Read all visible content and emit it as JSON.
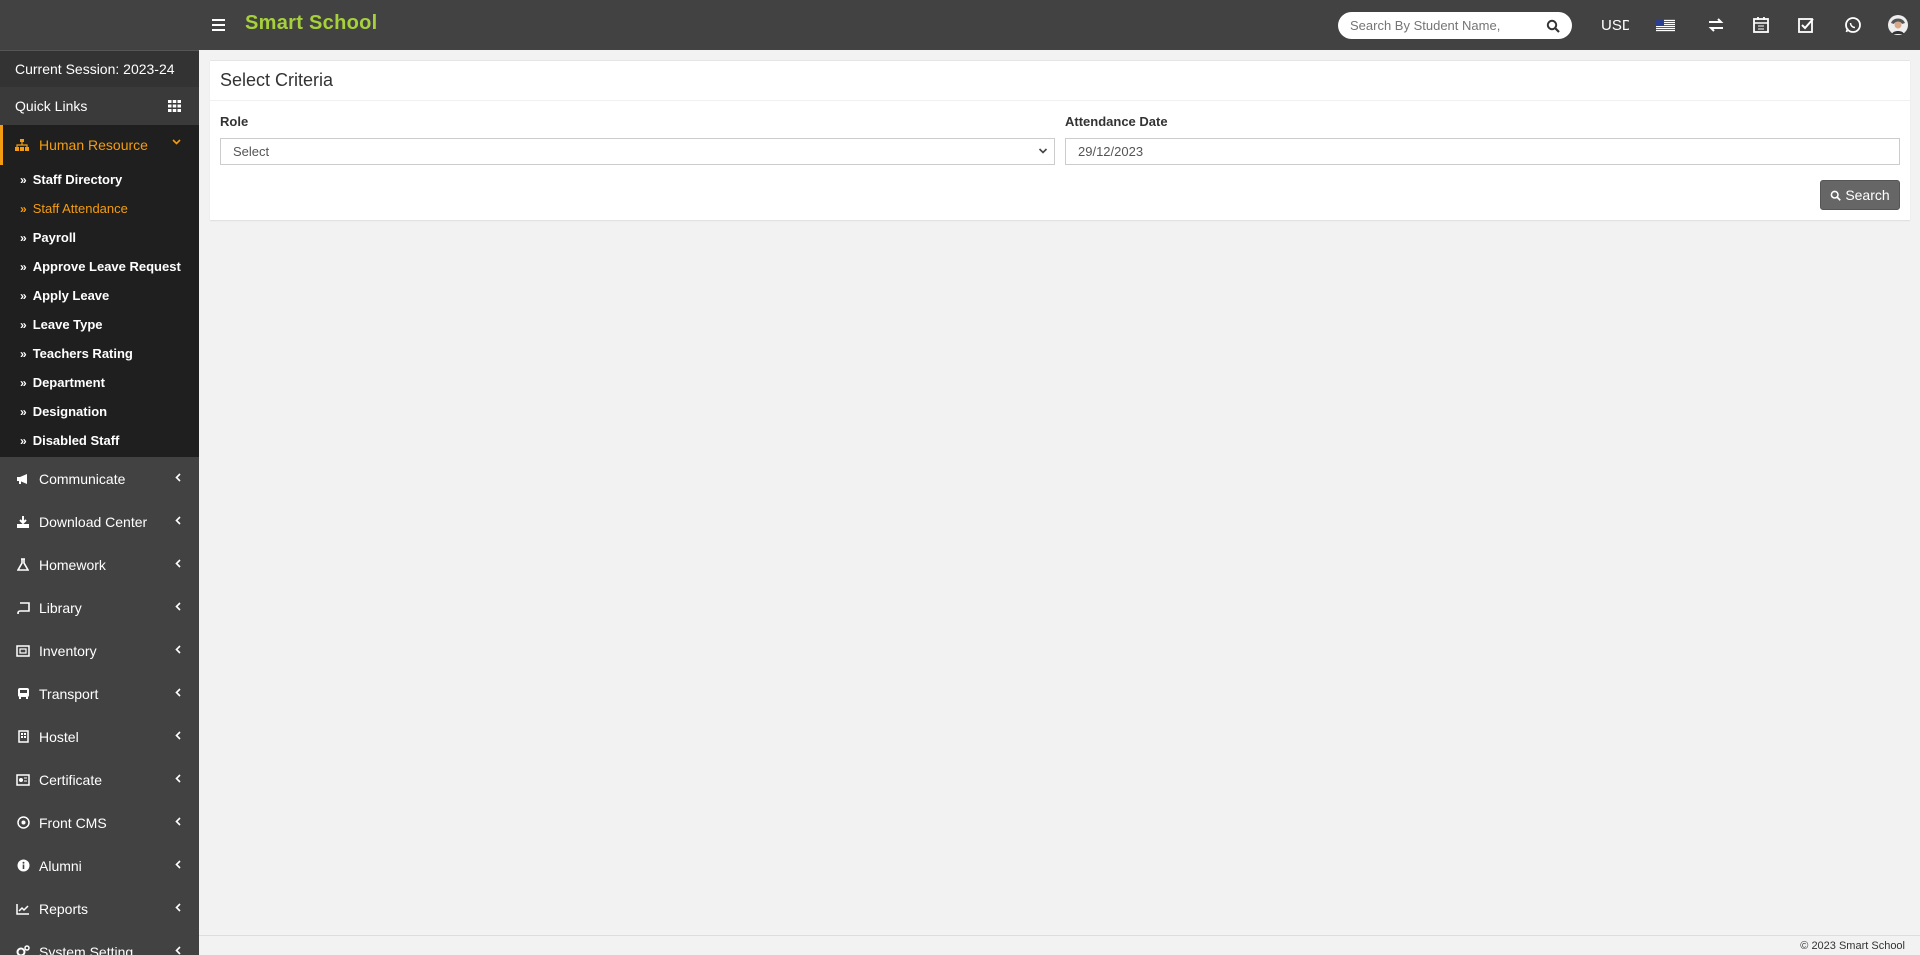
{
  "header": {
    "brand": "Smart School",
    "search_placeholder": "Search By Student Name,",
    "currency": "USD"
  },
  "sidebar": {
    "session": "Current Session: 2023-24",
    "quick_links": "Quick Links",
    "active_module": "Human Resource",
    "sub_items": [
      {
        "label": "Staff Directory"
      },
      {
        "label": "Staff Attendance"
      },
      {
        "label": "Payroll"
      },
      {
        "label": "Approve Leave Request"
      },
      {
        "label": "Apply Leave"
      },
      {
        "label": "Leave Type"
      },
      {
        "label": "Teachers Rating"
      },
      {
        "label": "Department"
      },
      {
        "label": "Designation"
      },
      {
        "label": "Disabled Staff"
      }
    ],
    "modules": [
      {
        "label": "Communicate",
        "icon": "bullhorn-icon"
      },
      {
        "label": "Download Center",
        "icon": "download-icon"
      },
      {
        "label": "Homework",
        "icon": "flask-icon"
      },
      {
        "label": "Library",
        "icon": "book-icon"
      },
      {
        "label": "Inventory",
        "icon": "inventory-icon"
      },
      {
        "label": "Transport",
        "icon": "bus-icon"
      },
      {
        "label": "Hostel",
        "icon": "building-icon"
      },
      {
        "label": "Certificate",
        "icon": "certificate-icon"
      },
      {
        "label": "Front CMS",
        "icon": "cms-icon"
      },
      {
        "label": "Alumni",
        "icon": "info-icon"
      },
      {
        "label": "Reports",
        "icon": "line-chart-icon"
      },
      {
        "label": "System Setting",
        "icon": "cogs-icon"
      }
    ]
  },
  "criteria": {
    "title": "Select Criteria",
    "role_label": "Role",
    "role_value": "Select",
    "date_label": "Attendance Date",
    "date_value": "29/12/2023",
    "search_button": "Search"
  },
  "footer": {
    "copyright": "© 2023 Smart School"
  },
  "colors": {
    "header_bg": "#424242",
    "brand": "#a7d13a",
    "active": "#f39c12",
    "sidebar_active_bg": "#1f1f1f"
  }
}
